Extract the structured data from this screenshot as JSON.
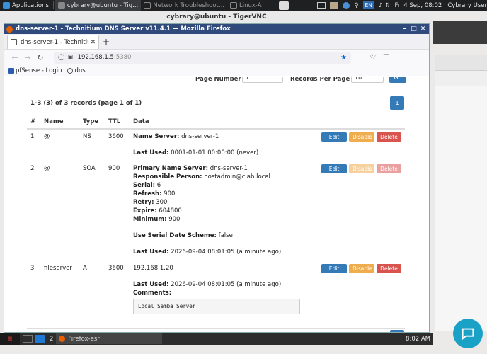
{
  "top_panel": {
    "applications_label": "Applications",
    "tasks": [
      {
        "label": "cybrary@ubuntu - Tig...",
        "icon": "vnc-icon",
        "active": true
      },
      {
        "label": "Network Troubleshoot...",
        "icon": "window-icon",
        "active": false
      },
      {
        "label": "Linux-A",
        "icon": "window-icon",
        "active": false
      }
    ],
    "keyboard_layout": "EN",
    "clock": "Fri 4 Sep, 08:02",
    "user": "Cybrary User"
  },
  "vnc": {
    "title": "cybrary@ubuntu - TigerVNC"
  },
  "firefox": {
    "window_title": "dns-server-1 - Technitium DNS Server v11.4.1 — Mozilla Firefox",
    "tab_title": "dns-server-1 - Technitium",
    "url_host": "192.168.1.5",
    "url_port": ":5380",
    "bookmarks": [
      "pfSense - Login",
      "dns"
    ]
  },
  "page": {
    "page_number_label": "Page Number",
    "page_number_value": "1",
    "records_per_page_label": "Records Per Page",
    "records_per_page_value": "10",
    "go_label": "Go",
    "summary": "1-3 (3) of 3 records (page 1 of 1)",
    "current_page": "1",
    "columns": [
      "#",
      "Name",
      "Type",
      "TTL",
      "Data"
    ],
    "actions": {
      "edit": "Edit",
      "disable": "Disable",
      "delete": "Delete"
    },
    "records": [
      {
        "num": "1",
        "name": "@",
        "type": "NS",
        "ttl": "3600",
        "fields": [
          {
            "label": "Name Server:",
            "value": " dns-server-1"
          }
        ],
        "last_used_label": "Last Used:",
        "last_used": " 0001-01-01 00:00:00 (never)"
      },
      {
        "num": "2",
        "name": "@",
        "type": "SOA",
        "ttl": "900",
        "fields": [
          {
            "label": "Primary Name Server:",
            "value": " dns-server-1"
          },
          {
            "label": "Responsible Person:",
            "value": " hostadmin@clab.local"
          },
          {
            "label": "Serial:",
            "value": " 6"
          },
          {
            "label": "Refresh:",
            "value": " 900"
          },
          {
            "label": "Retry:",
            "value": " 300"
          },
          {
            "label": "Expire:",
            "value": " 604800"
          },
          {
            "label": "Minimum:",
            "value": " 900"
          }
        ],
        "serial_scheme_label": "Use Serial Date Scheme:",
        "serial_scheme": " false",
        "last_used_label": "Last Used:",
        "last_used": " 2026-09-04 08:01:05 (a minute ago)"
      },
      {
        "num": "3",
        "name": "fileserver",
        "type": "A",
        "ttl": "3600",
        "address": "192.168.1.20",
        "last_used_label": "Last Used:",
        "last_used": " 2026-09-04 08:01:05 (a minute ago)",
        "comments_label": "Comments:",
        "comments": "Local Samba Server"
      }
    ]
  },
  "taskbar": {
    "workspace_count": "2",
    "app_label": "Firefox-esr",
    "time": "8:02 AM"
  },
  "colors": {
    "primary": "#337ab7",
    "warning": "#f0ad4e",
    "danger": "#d9534f",
    "firefox_title": "#314a7c",
    "chat": "#1aa1c6"
  }
}
